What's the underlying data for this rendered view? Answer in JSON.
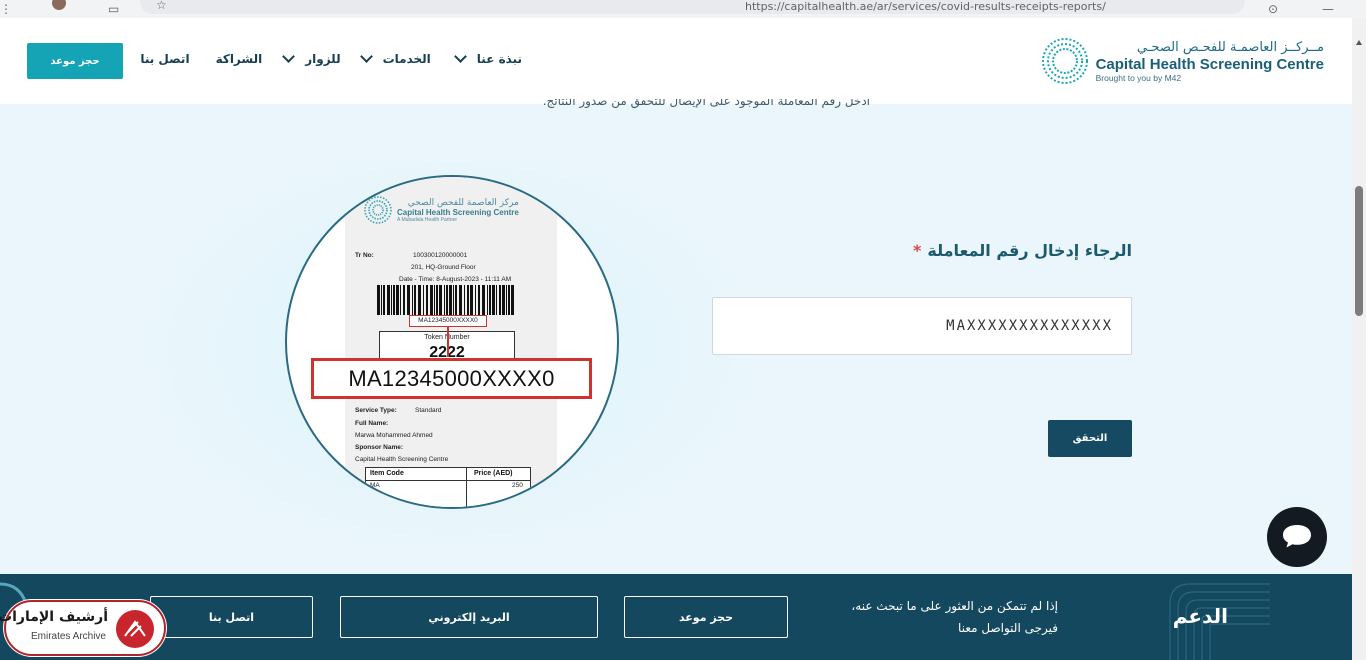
{
  "browser": {
    "url": "https://capitalhealth.ae/ar/services/covid-results-receipts-reports/"
  },
  "header": {
    "logo_ar": "مــركــز العاصمـة للفحـص الصحـي",
    "logo_en": "Capital Health Screening Centre",
    "logo_sub": "Brought to you by M42",
    "nav": [
      {
        "label": "نبذة عنا",
        "has_dropdown": true
      },
      {
        "label": "الخدمات",
        "has_dropdown": true
      },
      {
        "label": "للزوار",
        "has_dropdown": true
      },
      {
        "label": "الشراكة",
        "has_dropdown": false
      },
      {
        "label": "اتصل بنا",
        "has_dropdown": false
      }
    ],
    "book_button": "حجز موعد"
  },
  "intro_text": "أدخل رقم المعاملة الموجود على الإيصال للتحقق من صدور النتائج.",
  "receipt": {
    "logo_ar": "مركز العاصمة للفحص الصحي",
    "logo_en": "Capital Health Screening Centre",
    "logo_sub": "A Mubadala Health Partner",
    "tr_label": "Tr No:",
    "tr_value": "100300120000001",
    "location": "201, HQ-Ground Floor",
    "datetime": "Date - Time: 8-August-2023 - 11:11 AM",
    "barcode_text": "MA12345000XXXX0",
    "token_label": "Token Number",
    "token_number": "2222",
    "service_type_label": "Service Type:",
    "service_type_value": "Standard",
    "full_name_label": "Full Name:",
    "full_name_value": "Marwa Mohammed Ahmed",
    "sponsor_label": "Sponsor Name:",
    "sponsor_value": "Capital Health Screening Centre",
    "table_col_item": "Item Code",
    "table_col_price": "Price (AED)",
    "table_row_item": "MA",
    "table_row_price": "250",
    "magnified_code": "MA12345000XXXX0"
  },
  "form": {
    "label": "الرجاء إدخال رقم المعاملة",
    "required_mark": "*",
    "input_value": "MAXXXXXXXXXXXXXX",
    "verify_button": "التحقق"
  },
  "footer": {
    "title": "الدعم",
    "message_line1": "إذا لم تتمكن من العثور على ما تبحث عنه،",
    "message_line2": "فيرجى التواصل معنا",
    "btn_book": "حجز موعد",
    "btn_email": "البريد إلكتروني",
    "btn_contact": "اتصل بنا"
  },
  "watermark": {
    "ar": "أرشيف الإمارات",
    "en": "Emirates Archive"
  },
  "colors": {
    "teal_button": "#14a4b6",
    "navy_button": "#164a63",
    "footer_bg": "#14485e",
    "highlight_red": "#d0332f"
  },
  "icons": {
    "chat": "chat-bubble-icon",
    "chevron": "chevron-down-icon",
    "star": "star-icon"
  }
}
